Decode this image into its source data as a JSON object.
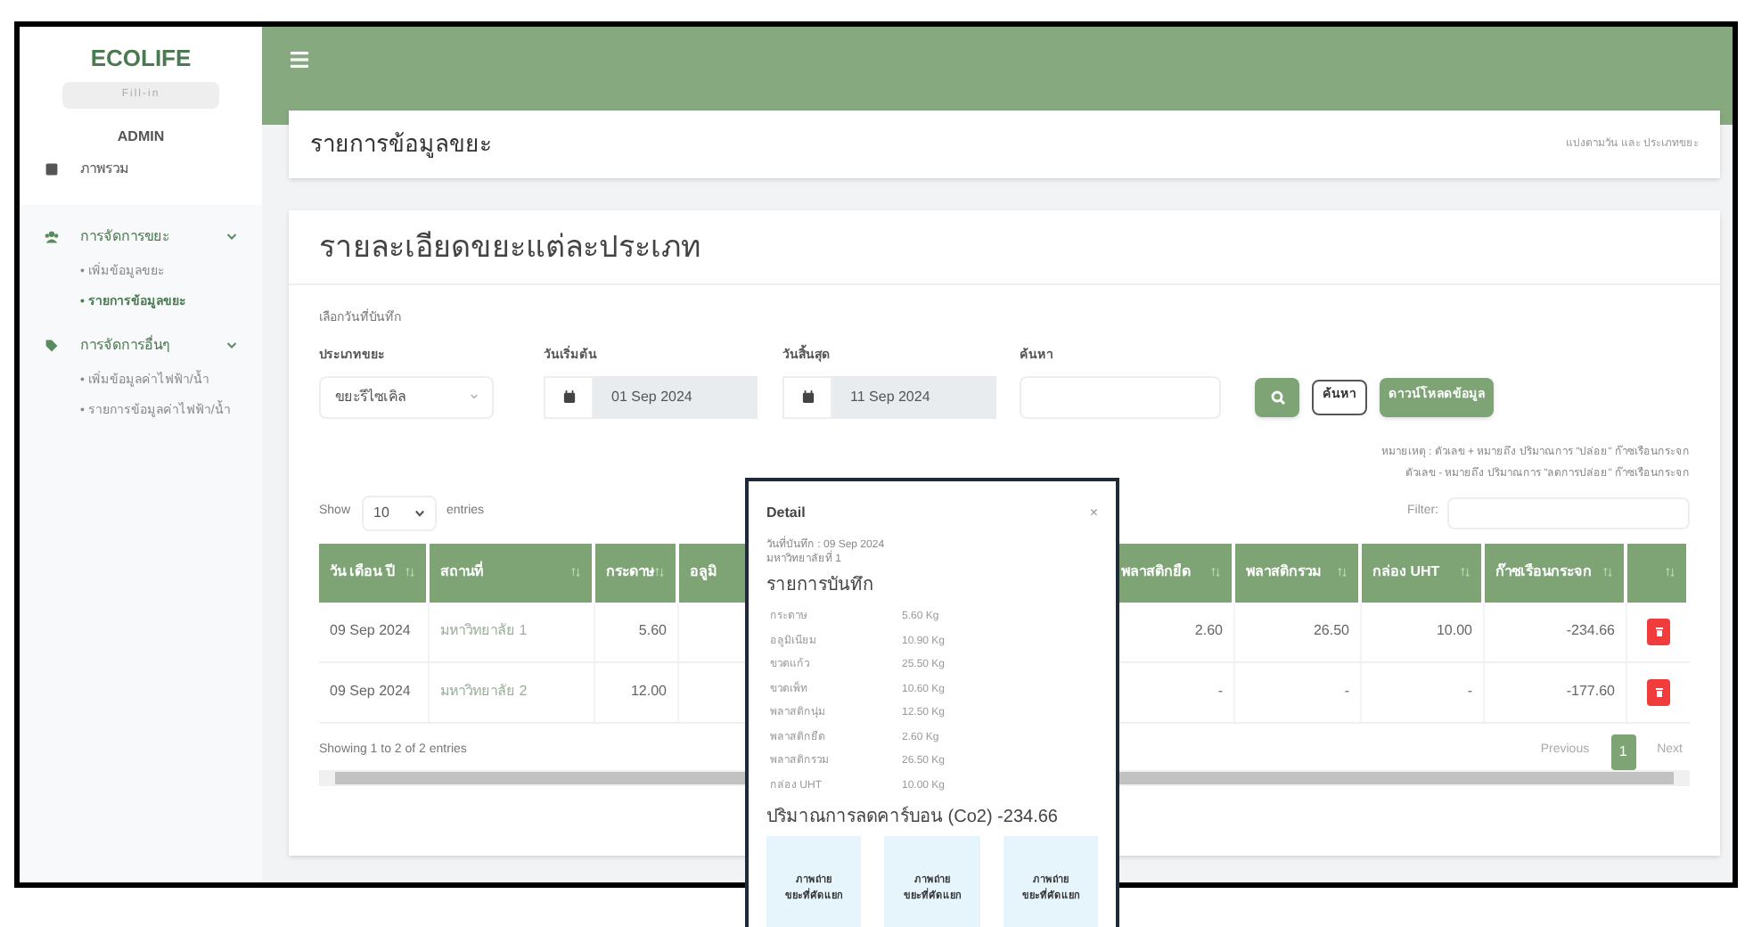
{
  "sidebar": {
    "brand": "ECOLIFE",
    "subtitle": "Fill-in",
    "role": "ADMIN",
    "items": [
      {
        "label": "ภาพรวม"
      },
      {
        "label": "การจัดการขยะ",
        "expanded": true,
        "children": [
          {
            "label": "• เพิ่มข้อมูลขยะ",
            "selected": false
          },
          {
            "label": "• รายการข้อมูลขยะ",
            "selected": true
          }
        ]
      },
      {
        "label": "การจัดการอื่นๆ",
        "expanded": true,
        "children": [
          {
            "label": "• เพิ่มข้อมูลค่าไฟฟ้า/น้ำ",
            "selected": false
          },
          {
            "label": "• รายการข้อมูลค่าไฟฟ้า/น้ำ",
            "selected": false
          }
        ]
      }
    ]
  },
  "header": {
    "title": "รายการข้อมูลขยะ",
    "breadcrumb": "แบ่งตามวัน และ ประเภทขยะ"
  },
  "card": {
    "title": "รายละเอียดขยะแต่ละประเภท",
    "section_label": "เลือกวันที่บันทึก",
    "filters": [
      {
        "label": "ประเภทขยะ",
        "kind": "select",
        "value": "ขยะรีไซเคิล"
      },
      {
        "label": "วันเริ่มต้น",
        "kind": "date",
        "value": "01 Sep 2024"
      },
      {
        "label": "วันสิ้นสุด",
        "kind": "date",
        "value": "11 Sep 2024"
      },
      {
        "label": "ค้นหา",
        "kind": "text"
      }
    ],
    "buttons": [
      {
        "kind": "icon"
      },
      {
        "kind": "outline",
        "label": "ค้นหา"
      },
      {
        "kind": "primary",
        "label": "ดาวน์โหลดข้อมูล"
      }
    ],
    "notes": [
      "หมายเหตุ : ตัวเลข + หมายถึง ปริมาณการ \"ปล่อย\" ก๊าซเรือนกระจก",
      "ตัวเลข - หมายถึง ปริมาณการ \"ลดการปล่อย\" ก๊าซเรือนกระจก"
    ]
  },
  "table": {
    "show_label": "Show",
    "page_size": "10",
    "entries_label": "entries",
    "filter_label": "Filter:",
    "columns": [
      {
        "label": "วัน เดือน ปี",
        "kind": "data"
      },
      {
        "label": "สถานที่",
        "kind": "data"
      },
      {
        "label": "กระดาษ",
        "kind": "data"
      },
      {
        "label": "อลูมิ",
        "kind": "covered"
      },
      {
        "label": "พลาสติกยืด",
        "kind": "data"
      },
      {
        "label": "พลาสติกรวม",
        "kind": "data"
      },
      {
        "label": "กล่อง UHT",
        "kind": "data"
      },
      {
        "label": "ก๊าซเรือนกระจก",
        "kind": "data"
      },
      {
        "kind": "action"
      }
    ],
    "rows": [
      [
        "09 Sep 2024",
        "มหาวิทยาลัย 1",
        "5.60",
        "2.60",
        "26.50",
        "10.00",
        "-234.66"
      ],
      [
        "09 Sep 2024",
        "มหาวิทยาลัย 2",
        "12.00",
        "-",
        "-",
        "-",
        "-177.60"
      ]
    ],
    "info": "Showing 1 to 2 of 2 entries",
    "pagination": [
      {
        "label": "Previous",
        "selected": false
      },
      {
        "label": "1",
        "selected": true
      },
      {
        "label": "Next",
        "selected": false
      }
    ]
  },
  "modal": {
    "title": "Detail",
    "close": "×",
    "date_line": "วันที่บันทึก : 09 Sep 2024",
    "place": "มหาวิทยาลัยที่ 1",
    "section": "รายการบันทึก",
    "items": [
      {
        "name": "กระดาษ",
        "amount": "5.60 Kg"
      },
      {
        "name": "อลูมิเนียม",
        "amount": "10.90 Kg"
      },
      {
        "name": "ขวดแก้ว",
        "amount": "25.50 Kg"
      },
      {
        "name": "ขวดเพ็ท",
        "amount": "10.60 Kg"
      },
      {
        "name": "พลาสติกนุ่ม",
        "amount": "12.50 Kg"
      },
      {
        "name": "พลาสติกยืด",
        "amount": "2.60 Kg"
      },
      {
        "name": "พลาสติกรวม",
        "amount": "26.50 Kg"
      },
      {
        "name": "กล่อง UHT",
        "amount": "10.00 Kg"
      }
    ],
    "carbon": "ปริมาณการลดคาร์บอน (Co2) -234.66",
    "photos": [
      [
        "ภาพถ่าย",
        "ขยะที่คัดแยก"
      ],
      [
        "ภาพถ่าย",
        "ขยะที่คัดแยก"
      ],
      [
        "ภาพถ่าย",
        "ขยะที่คัดแยก"
      ]
    ]
  }
}
